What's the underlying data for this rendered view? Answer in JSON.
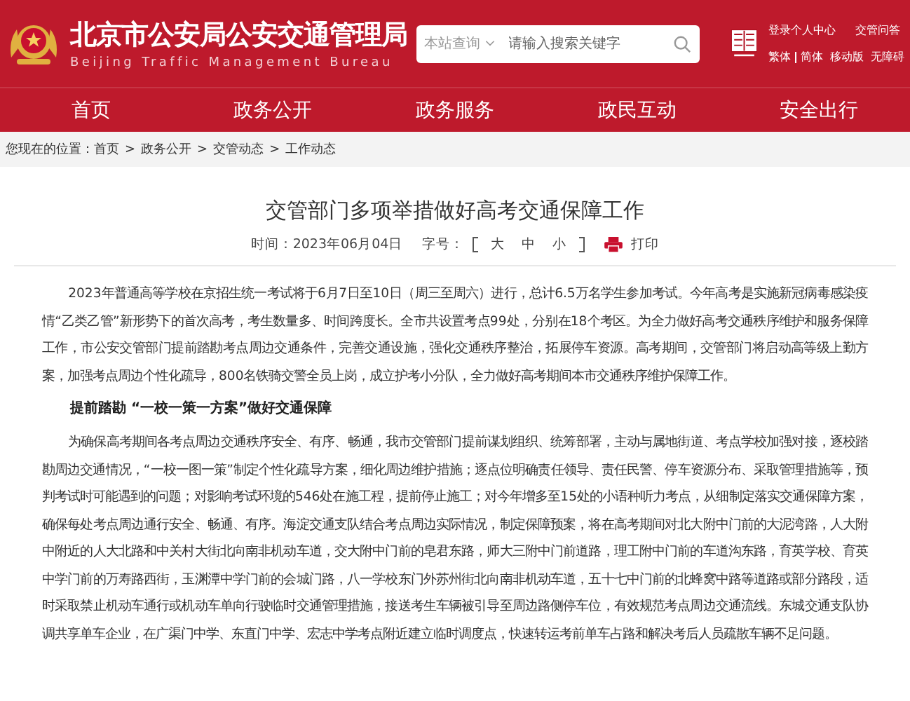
{
  "header": {
    "title": "北京市公安局公安交通管理局",
    "subtitle": "Beijing Traffic Management Bureau",
    "search": {
      "scope": "本站查询",
      "placeholder": "请输入搜索关键字"
    },
    "links_top": [
      "登录个人中心",
      "交管问答"
    ],
    "links_bottom": [
      "繁体",
      "简体",
      "移动版",
      "无障碍"
    ]
  },
  "nav": [
    "首页",
    "政务公开",
    "政务服务",
    "政民互动",
    "安全出行"
  ],
  "breadcrumb": {
    "label": "您现在的位置：",
    "separator": ">",
    "items": [
      "首页",
      "政务公开",
      "交管动态",
      "工作动态"
    ]
  },
  "article": {
    "title": "交管部门多项举措做好高考交通保障工作",
    "time_label": "时间：",
    "time": "2023年06月04日",
    "size_label": "字号：",
    "sizes": [
      "大",
      "中",
      "小"
    ],
    "print": "打印",
    "blocks": [
      {
        "kind": "paragraph",
        "text": "2023年普通高等学校在京招生统一考试将于6月7日至10日（周三至周六）进行，总计6.5万名学生参加考试。今年高考是实施新冠病毒感染疫情“乙类乙管”新形势下的首次高考，考生数量多、时间跨度长。全市共设置考点99处，分别在18个考区。为全力做好高考交通秩序维护和服务保障工作，市公安交管部门提前踏勘考点周边交通条件，完善交通设施，强化交通秩序整治，拓展停车资源。高考期间，交管部门将启动高等级上勤方案，加强考点周边个性化疏导，800名铁骑交警全员上岗，成立护考小分队，全力做好高考期间本市交通秩序维护保障工作。"
      },
      {
        "kind": "heading",
        "text": "提前踏勘 “一校一策一方案”做好交通保障"
      },
      {
        "kind": "paragraph",
        "text": "为确保高考期间各考点周边交通秩序安全、有序、畅通，我市交管部门提前谋划组织、统筹部署，主动与属地街道、考点学校加强对接，逐校踏勘周边交通情况，“一校一图一策”制定个性化疏导方案，细化周边维护措施；逐点位明确责任领导、责任民警、停车资源分布、采取管理措施等，预判考试时可能遇到的问题；对影响考试环境的546处在施工程，提前停止施工；对今年增多至15处的小语种听力考点，从细制定落实交通保障方案，确保每处考点周边通行安全、畅通、有序。海淀交通支队结合考点周边实际情况，制定保障预案，将在高考期间对北大附中门前的大泥湾路，人大附中附近的人大北路和中关村大街北向南非机动车道，交大附中门前的皂君东路，师大三附中门前道路，理工附中门前的车道沟东路，育英学校、育英中学门前的万寿路西街，玉渊潭中学门前的会城门路，八一学校东门外苏州街北向南非机动车道，五十七中门前的北蜂窝中路等道路或部分路段，适时采取禁止机动车通行或机动车单向行驶临时交通管理措施，接送考生车辆被引导至周边路侧停车位，有效规范考点周边交通流线。东城交通支队协调共享单车企业，在广渠门中学、东直门中学、宏志中学考点附近建立临时调度点，快速转运考前单车占路和解决考后人员疏散车辆不足问题。"
      }
    ]
  }
}
